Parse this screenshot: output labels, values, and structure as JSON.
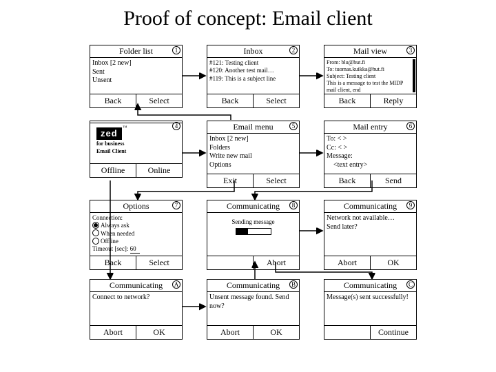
{
  "title": "Proof of concept: Email client",
  "panels": {
    "1": {
      "title": "Folder list",
      "num": "1",
      "lines": [
        "Inbox [2 new]",
        "Sent",
        "Unsent"
      ],
      "btns": [
        "Back",
        "Select"
      ]
    },
    "2": {
      "title": "Inbox",
      "num": "2",
      "lines": [
        "#121: Testing client",
        "#120: Another test mail…",
        "#119: This is a subject line"
      ],
      "btns": [
        "Back",
        "Select"
      ]
    },
    "3": {
      "title": "Mail view",
      "num": "3",
      "lines": [
        "From: blu@hut.fi",
        "To: tuomas.kuikka@hut.fi",
        "Subject:  Testing client",
        "This is a message to test the MIDP mail client, end"
      ],
      "btns": [
        "Back",
        "Reply"
      ]
    },
    "4": {
      "title": "",
      "num": "4",
      "logo": "zed",
      "sub1": "for business",
      "sub2": "Email Client",
      "btns": [
        "Offline",
        "Online"
      ]
    },
    "5": {
      "title": "Email menu",
      "num": "5",
      "lines": [
        "Inbox [2 new]",
        "Folders",
        "Write new mail",
        "Options"
      ],
      "btns": [
        "Exit",
        "Select"
      ]
    },
    "6": {
      "title": "Mail entry",
      "num": "6",
      "lines": [
        "To: < >",
        "Cc: < >",
        "Message:",
        "    <text entry>"
      ],
      "btns": [
        "Back",
        "Send"
      ]
    },
    "7": {
      "title": "Options",
      "num": "7",
      "connLabel": "Connection:",
      "opts": [
        "Always ask",
        "When needed",
        "Offline"
      ],
      "timeoutLabel": "Timeout [sec]:",
      "timeoutVal": "60",
      "btns": [
        "Back",
        "Select"
      ]
    },
    "8": {
      "title": "Communicating",
      "num": "8",
      "line": "Sending message",
      "btns": [
        "",
        "Abort"
      ]
    },
    "9": {
      "title": "Communicating",
      "num": "9",
      "lines": [
        "Network not available…",
        "Send later?"
      ],
      "btns": [
        "Abort",
        "OK"
      ]
    },
    "A": {
      "title": "Communicating",
      "num": "A",
      "lines": [
        "Connect to network?"
      ],
      "btns": [
        "Abort",
        "OK"
      ]
    },
    "B": {
      "title": "Communicating",
      "num": "B",
      "lines": [
        "Unsent message found. Send now?"
      ],
      "btns": [
        "Abort",
        "OK"
      ]
    },
    "C": {
      "title": "Communicating",
      "num": "C",
      "lines": [
        "Message(s) sent successfully!"
      ],
      "btns": [
        "",
        "Continue"
      ]
    }
  }
}
